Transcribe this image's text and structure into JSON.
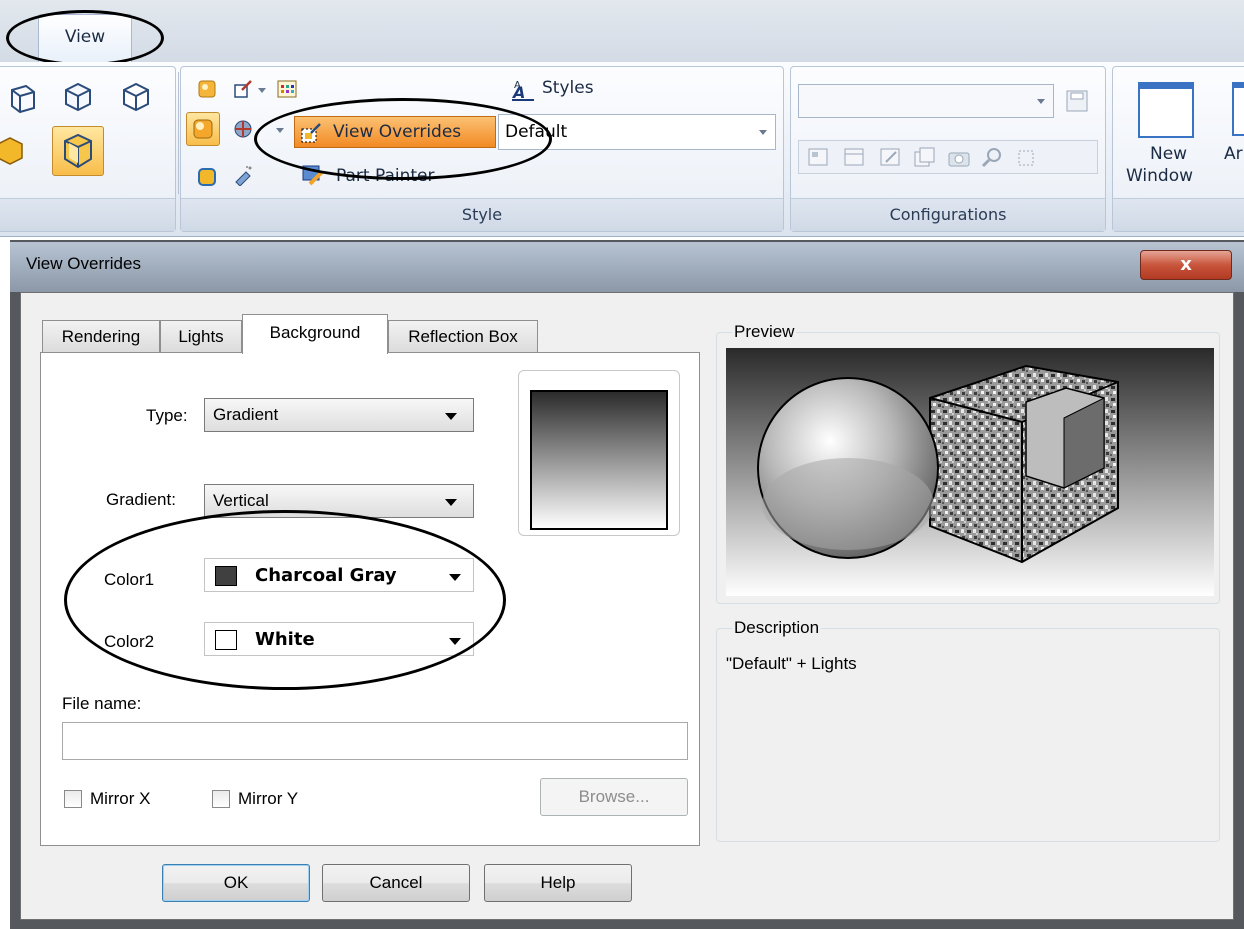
{
  "ribbon": {
    "tab_label": "View",
    "style_group": {
      "label": "Style",
      "styles_label": "Styles",
      "view_overrides_label": "View Overrides",
      "style_combo_value": "Default",
      "part_painter_label": "Part Painter"
    },
    "config_group": {
      "label": "Configurations",
      "combo_value": ""
    },
    "window_group": {
      "new_window_line1": "New",
      "new_window_line2": "Window",
      "arrange_partial": "Ar"
    }
  },
  "dialog": {
    "title": "View Overrides",
    "close_glyph": "x",
    "tabs": [
      "Rendering",
      "Lights",
      "Background",
      "Reflection Box"
    ],
    "active_tab": "Background",
    "background": {
      "type_label": "Type:",
      "type_value": "Gradient",
      "gradient_label": "Gradient:",
      "gradient_value": "Vertical",
      "color1_label": "Color1",
      "color1_value": "Charcoal Gray",
      "color1_hex": "#404040",
      "color2_label": "Color2",
      "color2_value": "White",
      "color2_hex": "#ffffff",
      "file_name_label": "File name:",
      "file_name_value": "",
      "mirror_x_label": "Mirror X",
      "mirror_x_checked": false,
      "mirror_y_label": "Mirror Y",
      "mirror_y_checked": false,
      "browse_label": "Browse..."
    },
    "preview": {
      "label": "Preview"
    },
    "description": {
      "label": "Description",
      "text": "\"Default\" + Lights"
    },
    "buttons": {
      "ok": "OK",
      "cancel": "Cancel",
      "help": "Help"
    }
  },
  "colors": {
    "highlight_orange": "#f7a54a",
    "dialog_frame": "#55585c",
    "close_red": "#c8553c"
  }
}
